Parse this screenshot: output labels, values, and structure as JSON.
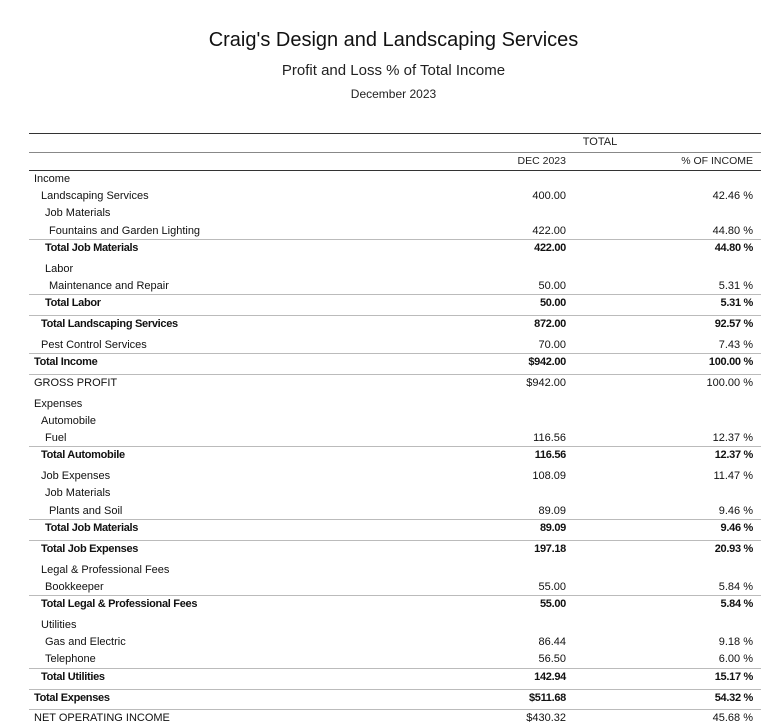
{
  "report": {
    "company": "Craig's Design and Landscaping Services",
    "title": "Profit and Loss % of Total Income",
    "period": "December 2023"
  },
  "columns": {
    "group": "TOTAL",
    "col1": "DEC 2023",
    "col2": "% OF INCOME"
  },
  "rows": [
    {
      "label": "Income",
      "v1": "",
      "v2": ""
    },
    {
      "label": "Landscaping Services",
      "v1": "400.00",
      "v2": "42.46 %"
    },
    {
      "label": "Job Materials",
      "v1": "",
      "v2": ""
    },
    {
      "label": "Fountains and Garden Lighting",
      "v1": "422.00",
      "v2": "44.80 %"
    },
    {
      "label": "Total Job Materials",
      "v1": "422.00",
      "v2": "44.80 %"
    },
    {
      "label": "Labor",
      "v1": "",
      "v2": ""
    },
    {
      "label": "Maintenance and Repair",
      "v1": "50.00",
      "v2": "5.31 %"
    },
    {
      "label": "Total Labor",
      "v1": "50.00",
      "v2": "5.31 %"
    },
    {
      "label": "Total Landscaping Services",
      "v1": "872.00",
      "v2": "92.57 %"
    },
    {
      "label": "Pest Control Services",
      "v1": "70.00",
      "v2": "7.43 %"
    },
    {
      "label": "Total Income",
      "v1": "$942.00",
      "v2": "100.00 %"
    },
    {
      "label": "GROSS PROFIT",
      "v1": "$942.00",
      "v2": "100.00 %"
    },
    {
      "label": "Expenses",
      "v1": "",
      "v2": ""
    },
    {
      "label": "Automobile",
      "v1": "",
      "v2": ""
    },
    {
      "label": "Fuel",
      "v1": "116.56",
      "v2": "12.37 %"
    },
    {
      "label": "Total Automobile",
      "v1": "116.56",
      "v2": "12.37 %"
    },
    {
      "label": "Job Expenses",
      "v1": "108.09",
      "v2": "11.47 %"
    },
    {
      "label": "Job Materials",
      "v1": "",
      "v2": ""
    },
    {
      "label": "Plants and Soil",
      "v1": "89.09",
      "v2": "9.46 %"
    },
    {
      "label": "Total Job Materials",
      "v1": "89.09",
      "v2": "9.46 %"
    },
    {
      "label": "Total Job Expenses",
      "v1": "197.18",
      "v2": "20.93 %"
    },
    {
      "label": "Legal & Professional Fees",
      "v1": "",
      "v2": ""
    },
    {
      "label": "Bookkeeper",
      "v1": "55.00",
      "v2": "5.84 %"
    },
    {
      "label": "Total Legal & Professional Fees",
      "v1": "55.00",
      "v2": "5.84 %"
    },
    {
      "label": "Utilities",
      "v1": "",
      "v2": ""
    },
    {
      "label": "Gas and Electric",
      "v1": "86.44",
      "v2": "9.18 %"
    },
    {
      "label": "Telephone",
      "v1": "56.50",
      "v2": "6.00 %"
    },
    {
      "label": "Total Utilities",
      "v1": "142.94",
      "v2": "15.17 %"
    },
    {
      "label": "Total Expenses",
      "v1": "$511.68",
      "v2": "54.32 %"
    },
    {
      "label": "NET OPERATING INCOME",
      "v1": "$430.32",
      "v2": "45.68 %"
    }
  ]
}
